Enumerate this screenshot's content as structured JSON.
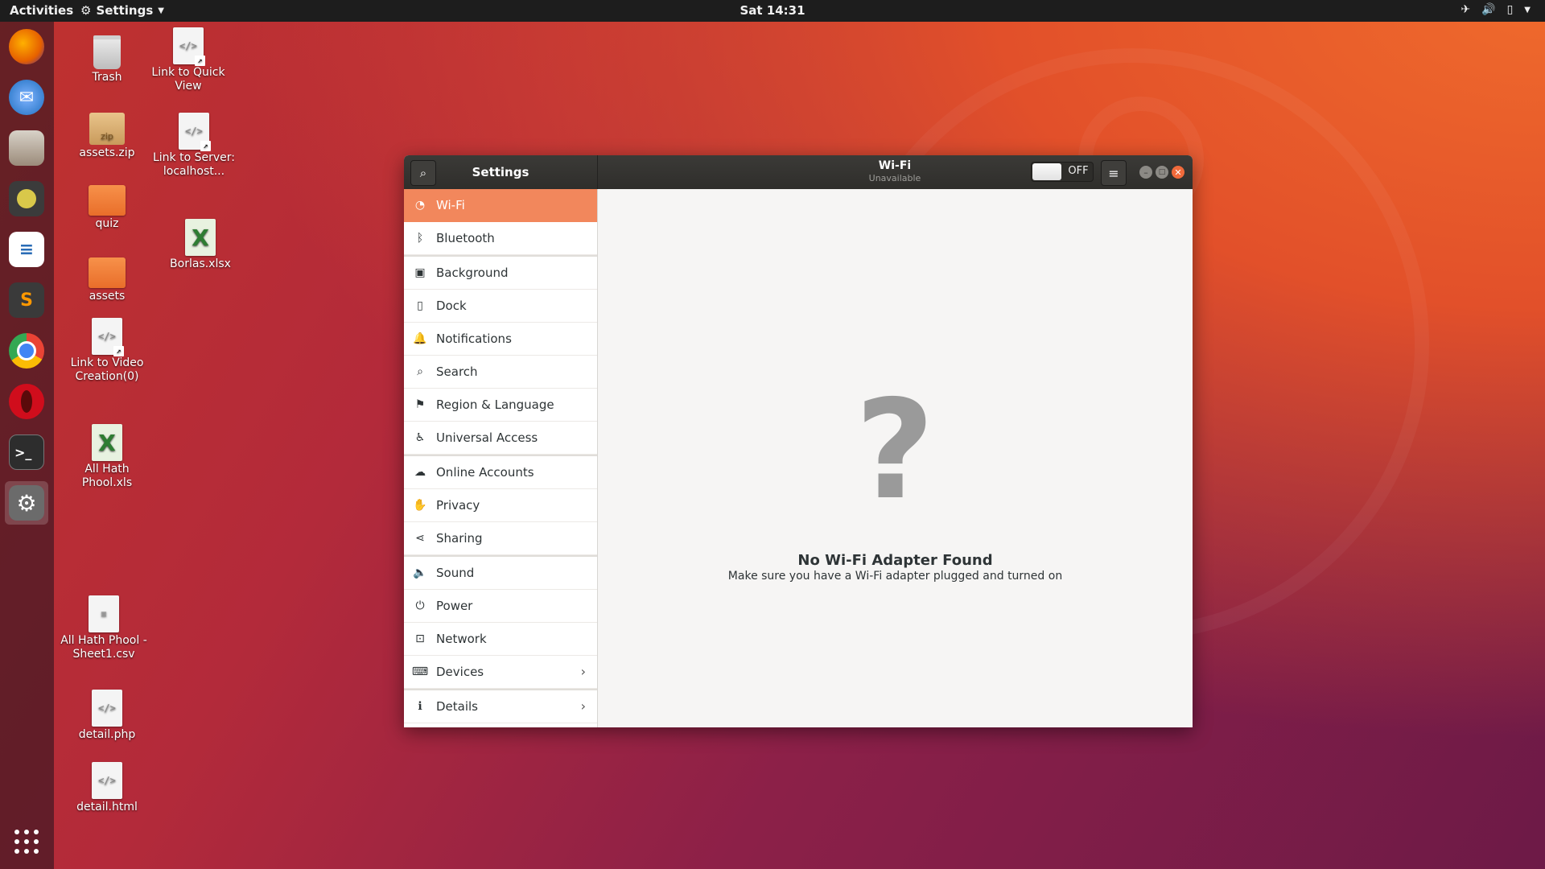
{
  "topbar": {
    "activities": "Activities",
    "app_name": "Settings",
    "clock": "Sat 14:31"
  },
  "dock": {
    "apps": [
      {
        "name": "firefox-icon",
        "color": "#e66000"
      },
      {
        "name": "thunderbird-icon",
        "color": "#1f6fbf"
      },
      {
        "name": "files-icon",
        "color": "#9b8b7a"
      },
      {
        "name": "rhythmbox-icon",
        "color": "#d9c84a"
      },
      {
        "name": "libreoffice-writer-icon",
        "color": "#2a6cb6"
      },
      {
        "name": "sublime-text-icon",
        "color": "#ff9800"
      },
      {
        "name": "chrome-icon",
        "color": "#34a853"
      },
      {
        "name": "opera-icon",
        "color": "#d00d1c"
      },
      {
        "name": "terminal-icon",
        "color": "#2d2d2d"
      },
      {
        "name": "settings-icon",
        "color": "#7a7a7a"
      }
    ]
  },
  "desktop": {
    "icons": [
      {
        "label": "Trash"
      },
      {
        "label": "assets.zip"
      },
      {
        "label": "quiz"
      },
      {
        "label": "assets"
      },
      {
        "label": "Link to Video Creation(0)"
      },
      {
        "label": "All Hath Phool.xls"
      },
      {
        "label": "All Hath Phool - Sheet1.csv"
      },
      {
        "label": "detail.php"
      },
      {
        "label": "detail.html"
      },
      {
        "label": "Link to Quick View"
      },
      {
        "label": "Link to Server: localhost..."
      },
      {
        "label": "Borlas.xlsx"
      }
    ],
    "zip_tag": "zip",
    "code_glyph": "</>",
    "xls_glyph": "X"
  },
  "window": {
    "sidebar_title": "Settings",
    "panel_title": "Wi-Fi",
    "panel_subtitle": "Unavailable",
    "switch_state": "OFF",
    "accent": "#f2875c"
  },
  "sidebar": {
    "items": [
      {
        "label": "Wi-Fi"
      },
      {
        "label": "Bluetooth"
      },
      {
        "label": "Background"
      },
      {
        "label": "Dock"
      },
      {
        "label": "Notifications"
      },
      {
        "label": "Search"
      },
      {
        "label": "Region & Language"
      },
      {
        "label": "Universal Access"
      },
      {
        "label": "Online Accounts"
      },
      {
        "label": "Privacy"
      },
      {
        "label": "Sharing"
      },
      {
        "label": "Sound"
      },
      {
        "label": "Power"
      },
      {
        "label": "Network"
      },
      {
        "label": "Devices"
      },
      {
        "label": "Details"
      }
    ]
  },
  "content": {
    "status_glyph": "?",
    "message_title": "No Wi-Fi Adapter Found",
    "message_body": "Make sure you have a Wi-Fi adapter plugged and turned on"
  }
}
